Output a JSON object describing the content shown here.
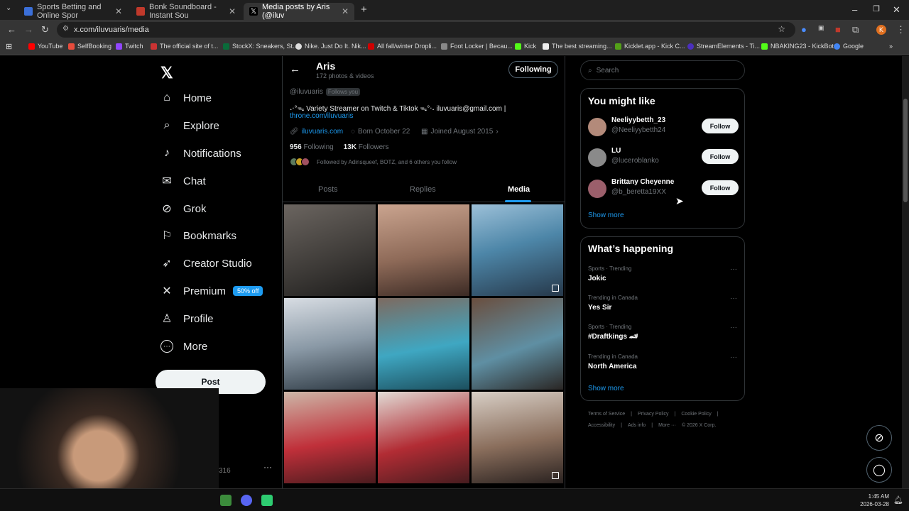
{
  "browser": {
    "tabs": [
      {
        "title": "Sports Betting and Online Spor",
        "favicon_color": "#3b6fd8"
      },
      {
        "title": "Bonk Soundboard - Instant Sou",
        "favicon_color": "#c0392b"
      },
      {
        "title": "Media posts by Aris (@iluv",
        "favicon_color": "#000000"
      }
    ],
    "url": "x.com/iluvuaris/media",
    "bookmarks": [
      {
        "label": "YouTube",
        "color": "#ff0000"
      },
      {
        "label": "SelfBooking",
        "color": "#e74c3c"
      },
      {
        "label": "Twitch",
        "color": "#9146ff"
      },
      {
        "label": "The official site of t...",
        "color": "#cc3333"
      },
      {
        "label": "StockX: Sneakers, St...",
        "color": "#0a6b3a"
      },
      {
        "label": "Nike. Just Do It. Nik...",
        "color": "#dddddd"
      },
      {
        "label": "All fall/winter Dropli...",
        "color": "#d00000"
      },
      {
        "label": "Foot Locker | Becau...",
        "color": "#888888"
      },
      {
        "label": "Kick",
        "color": "#53fc18"
      },
      {
        "label": "The best streaming...",
        "color": "#eeeeee"
      },
      {
        "label": "Kicklet.app - Kick C...",
        "color": "#53a018"
      },
      {
        "label": "StreamElements - Ti...",
        "color": "#4b2fbd"
      },
      {
        "label": "NBAKING23 - KickBot",
        "color": "#53fc18"
      },
      {
        "label": "Google",
        "color": "#4285f4"
      }
    ]
  },
  "sidebar": {
    "items": [
      {
        "label": "Home",
        "icon": "home-icon",
        "glyph": "⌂"
      },
      {
        "label": "Explore",
        "icon": "search-icon",
        "glyph": "⌕"
      },
      {
        "label": "Notifications",
        "icon": "bell-icon",
        "glyph": "♪"
      },
      {
        "label": "Chat",
        "icon": "mail-icon",
        "glyph": "✉"
      },
      {
        "label": "Grok",
        "icon": "grok-icon",
        "glyph": "⊘"
      },
      {
        "label": "Bookmarks",
        "icon": "bookmark-icon",
        "glyph": "⚐"
      },
      {
        "label": "Creator Studio",
        "icon": "rocket-icon",
        "glyph": "➶"
      },
      {
        "label": "Premium",
        "icon": "x-icon",
        "glyph": "✕"
      },
      {
        "label": "Profile",
        "icon": "person-icon",
        "glyph": "♙"
      },
      {
        "label": "More",
        "icon": "more-circle-icon",
        "glyph": "⋯"
      }
    ],
    "premium_badge": "50% off",
    "post_label": "Post",
    "partial_text": "316",
    "dots": "···"
  },
  "profile": {
    "name": "Aris",
    "count": "172 photos & videos",
    "following_label": "Following",
    "handle": "@iluvuaris",
    "follows_you": "Follows you",
    "bio": "˖‧°ᯓ Variety Streamer on Twitch & Tiktok ᯓ°‧˖ iluvuaris@gmail.com |",
    "bio_link": "throne.com/iluvuaris",
    "website": "iluvuaris.com",
    "born": "Born October 22",
    "joined": "Joined August 2015",
    "following_count": "956",
    "following_text": "Following",
    "followers_count": "13K",
    "followers_text": "Followers",
    "followed_by": "Followed by Adinsqueef, BOTZ, and 6 others you follow",
    "tabs": [
      "Posts",
      "Replies",
      "Media"
    ]
  },
  "media_tiles": [
    {
      "bg": "linear-gradient(160deg,#6b6560,#3d3a37 60%,#1c1b1a)",
      "multi": false
    },
    {
      "bg": "linear-gradient(170deg,#caa48f,#8e6a58 55%,#3b2a24)",
      "multi": false
    },
    {
      "bg": "linear-gradient(165deg,#9cc0d8,#4d86a8 45%,#26384a)",
      "multi": true
    },
    {
      "bg": "linear-gradient(170deg,#d8dde3,#8a99a6 50%,#2e3a44)",
      "multi": false
    },
    {
      "bg": "linear-gradient(170deg,#7d6a60,#3fa7c2 55%,#1c4f5e)",
      "multi": false
    },
    {
      "bg": "linear-gradient(160deg,#6a4e3e,#5f8fa3 55%,#2a2624)",
      "multi": false
    },
    {
      "bg": "linear-gradient(170deg,#cdb7a8,#c0303a 55%,#4a1b1e)",
      "multi": false
    },
    {
      "bg": "linear-gradient(165deg,#e1dcd6,#b22c34 55%,#461c1f)",
      "multi": false
    },
    {
      "bg": "linear-gradient(170deg,#d8cfc6,#8a6e5c 55%,#2a2220)",
      "multi": true
    }
  ],
  "right": {
    "search_placeholder": "Search",
    "you_might_like_title": "You might like",
    "suggestions": [
      {
        "name": "Neeliyybetth_23",
        "handle": "@Neeliyybetth24",
        "avatar": "#b38a7a"
      },
      {
        "name": "LU",
        "handle": "@luceroblanko",
        "avatar": "#8a8a8a"
      },
      {
        "name": "Brittany Cheyenne",
        "handle": "@b_beretta19XX",
        "avatar": "#9b5f6b"
      }
    ],
    "follow_label": "Follow",
    "show_more": "Show more",
    "whats_happening_title": "What’s happening",
    "trends": [
      {
        "category": "Sports · Trending",
        "title": "Jokic"
      },
      {
        "category": "Trending in Canada",
        "title": "Yes Sir"
      },
      {
        "category": "Sports · Trending",
        "title": "#Draftkings 🏎"
      },
      {
        "category": "Trending in Canada",
        "title": "North America"
      }
    ],
    "footer_line1": [
      "Terms of Service",
      "|",
      "Privacy Policy",
      "|",
      "Cookie Policy",
      "|"
    ],
    "footer_line2": [
      "Accessibility",
      "|",
      "Ads info",
      "|",
      "More ···",
      "© 2026 X Corp."
    ]
  },
  "taskbar": {
    "time": "1:45 AM",
    "date": "2026-03-28"
  }
}
